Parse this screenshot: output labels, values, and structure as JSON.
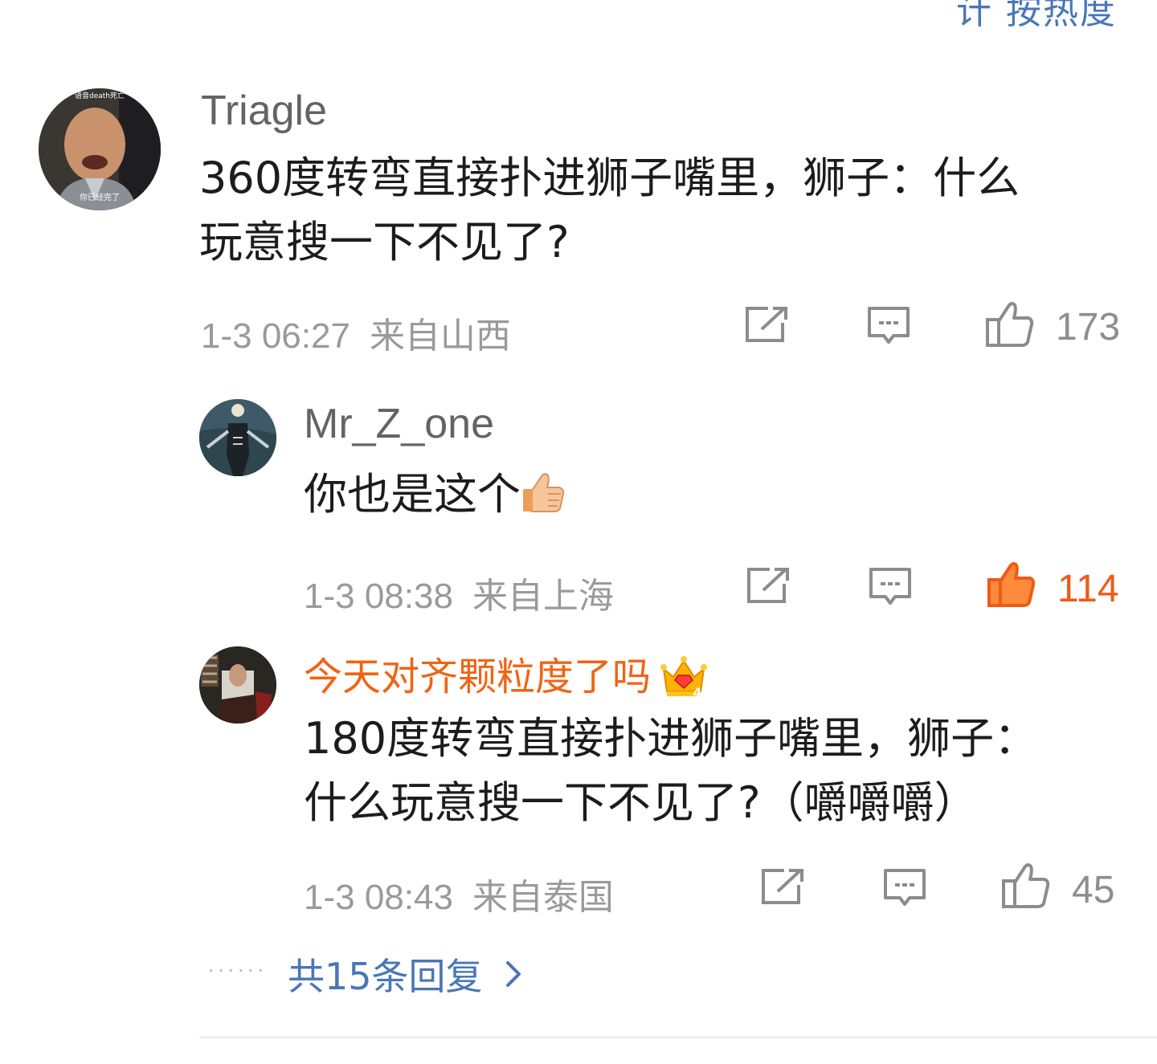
{
  "sort_toggle": {
    "label": "计 按热度"
  },
  "comments": [
    {
      "username": "Triagle",
      "avatar_caption_top": "语音death死亡",
      "avatar_caption_bottom": "你已经完了",
      "content_lines": [
        "360度转弯直接扑进狮子嘴里，狮子：什么",
        "玩意搜一下不见了?"
      ],
      "time": "1-3 06:27",
      "location": "来自山西",
      "likes": "173",
      "liked": false
    },
    {
      "username": "Mr_Z_one",
      "content": "你也是这个",
      "emoji": "thumbs-up-emoji",
      "time": "1-3 08:38",
      "location": "来自上海",
      "likes": "114",
      "liked": true
    },
    {
      "username": "今天对齐颗粒度了吗",
      "badge": "crown-vip-badge",
      "badge_level": "4",
      "content_lines": [
        "180度转弯直接扑进狮子嘴里，狮子：",
        "什么玩意搜一下不见了?（嚼嚼嚼）"
      ],
      "time": "1-3 08:43",
      "location": "来自泰国",
      "likes": "45",
      "liked": false
    }
  ],
  "more_replies": {
    "dots": "······",
    "label": "共15条回复"
  },
  "colors": {
    "link_blue": "#4a76b8",
    "vip_orange": "#f06414",
    "liked_orange": "#f05a14",
    "meta_gray": "#9a9a9a"
  }
}
